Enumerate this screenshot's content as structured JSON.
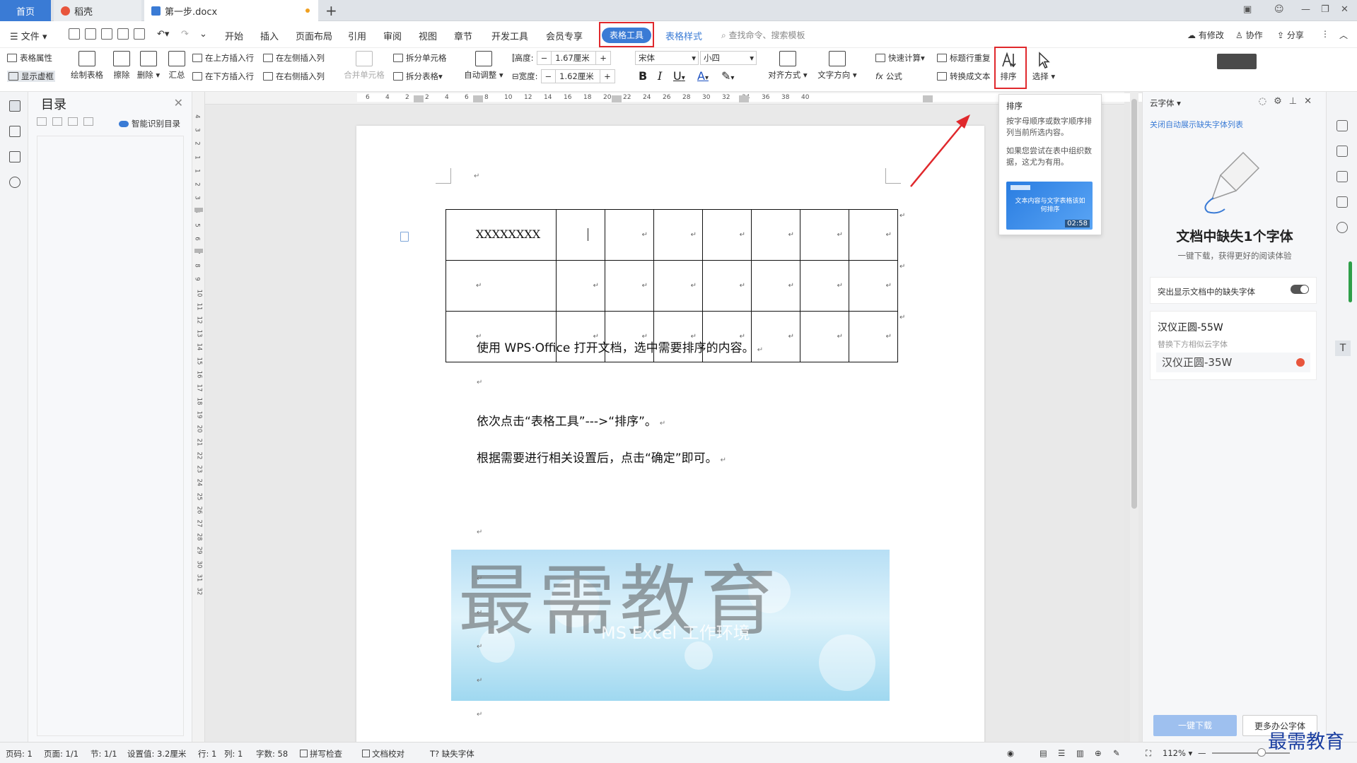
{
  "tabs": {
    "home": "首页",
    "daoke": "稻壳",
    "doc": "第一步.docx",
    "new_tab": "+"
  },
  "menu": {
    "file": "文件",
    "items": [
      "开始",
      "插入",
      "页面布局",
      "引用",
      "审阅",
      "视图",
      "章节",
      "开发工具",
      "会员专享"
    ],
    "table_tools": "表格工具",
    "table_style": "表格样式",
    "search_placeholder": "查找命令、搜索模板",
    "has_changes": "有修改",
    "collaborate": "协作",
    "share": "分享"
  },
  "ribbon": {
    "table_props": "表格属性",
    "show_gridlines": "显示虚框",
    "draw_table": "绘制表格",
    "erase": "擦除",
    "delete": "删除",
    "summary": "汇总",
    "insert_row_above": "在上方插入行",
    "insert_row_below": "在下方插入行",
    "insert_col_left": "在左侧插入列",
    "insert_col_right": "在右侧插入列",
    "merge_cells": "合并单元格",
    "split_cells": "拆分单元格",
    "split_table": "拆分表格",
    "auto_fit": "自动调整",
    "height_label": "高度:",
    "height_value": "1.67厘米",
    "width_label": "宽度:",
    "width_value": "1.62厘米",
    "font_name": "宋体",
    "font_size": "小四",
    "align": "对齐方式",
    "text_direction": "文字方向",
    "quick_calc": "快速计算",
    "formula": "公式",
    "repeat_header": "标题行重复",
    "convert_to_text": "转换成文本",
    "sort": "排序",
    "select": "选择"
  },
  "toc": {
    "title": "目录",
    "smart": "智能识别目录"
  },
  "ruler": {
    "h_numbers": [
      "6",
      "4",
      "2",
      "2",
      "4",
      "6",
      "8",
      "10",
      "12",
      "14",
      "16",
      "18",
      "20",
      "22",
      "24",
      "26",
      "28",
      "30",
      "32",
      "34",
      "36",
      "38",
      "40"
    ],
    "v_numbers": [
      "4",
      "3",
      "2",
      "1",
      "1",
      "2",
      "3",
      "4",
      "5",
      "6",
      "7",
      "8",
      "9",
      "10",
      "11",
      "12",
      "13",
      "14",
      "15",
      "16",
      "17",
      "18",
      "19",
      "20",
      "21",
      "22",
      "23",
      "24",
      "25",
      "26",
      "27",
      "28",
      "29",
      "30",
      "31",
      "32"
    ]
  },
  "document": {
    "cell_text": "XXXXXXXX",
    "para1": "使用 WPS·Office 打开文档，选中需要排序的内容。",
    "para2": "依次点击“表格工具”--->“排序”。",
    "para3": "根据需要进行相关设置后，点击“确定”即可。",
    "watermark": "最需教育",
    "banner_text": "MS Excel 工作环境",
    "para_mark": "↵"
  },
  "tooltip": {
    "title": "排序",
    "desc1": "按字母顺序或数字顺序排列当前所选内容。",
    "desc2": "如果您尝试在表中组织数据，这尤为有用。",
    "video_title": "文本内容与文字表格该如何排序",
    "video_duration": "02:58"
  },
  "cloud_font": {
    "header": "云字体",
    "close_link": "关闭自动展示缺失字体列表",
    "title": "文档中缺失1个字体",
    "subtitle": "一键下载，获得更好的阅读体验",
    "highlight_toggle": "突出显示文档中的缺失字体",
    "missing_font": "汉仪正圆-55W",
    "replace_hint": "替换下方相似云字体",
    "replacement_font": "汉仪正圆-35W",
    "download_btn": "一键下载",
    "more_btn": "更多办公字体"
  },
  "status": {
    "page_num": "页码: 1",
    "pages": "页面: 1/1",
    "section": "节: 1/1",
    "setting": "设置值: 3.2厘米",
    "row": "行: 1",
    "col": "列: 1",
    "words": "字数: 58",
    "spellcheck": "拼写检查",
    "doc_proof": "文档校对",
    "missing_font": "缺失字体",
    "zoom": "112%",
    "brand": "最需教育"
  },
  "colors": {
    "accent": "#3a7bd5",
    "highlight": "#e0282c",
    "brand_watermark": "#1a3ea0"
  }
}
